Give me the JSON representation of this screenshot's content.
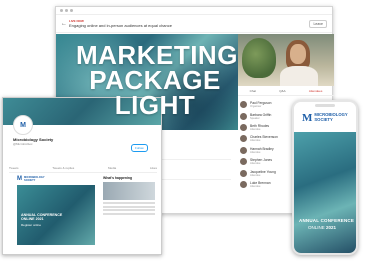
{
  "hero": {
    "title_line1": "MARKETING",
    "title_line2": "PACKAGE",
    "title_line3": "LIGHT"
  },
  "event_platform": {
    "session_tag": "LIVE NOW",
    "session_title": "Engaging online and in-person audiences at equal chance",
    "leave_label": "Leave",
    "tabs": [
      "Chat",
      "Q&A",
      "Attendees"
    ],
    "attendees": [
      {
        "name": "Paul Ferguson",
        "role": "Organiser"
      },
      {
        "name": "Barbara Griffin",
        "role": "Speaker"
      },
      {
        "name": "Beth Rhodes",
        "role": "Attendee"
      },
      {
        "name": "Charles Stevenson",
        "role": "Attendee"
      },
      {
        "name": "Hannah Bradley",
        "role": "Attendee"
      },
      {
        "name": "Stephen Jones",
        "role": "Attendee"
      },
      {
        "name": "Jacqueline Young",
        "role": "Attendee"
      },
      {
        "name": "Luke Brennan",
        "role": "Attendee"
      }
    ],
    "agenda_label": "SESSION INFO",
    "hosted_label": "Hosted",
    "speakers_label": "SPEAKERS",
    "hosts": [
      {
        "name": "Angel Hunter",
        "role": "Organiser"
      }
    ],
    "speakers": [
      {
        "name": "Steve Holloran",
        "role": "Speaker"
      }
    ]
  },
  "twitter": {
    "account_name": "Microbiology Society",
    "handle": "@MicrobioSoc",
    "tabs": [
      "Tweets",
      "Tweets & replies",
      "Media",
      "Likes"
    ],
    "follow_label": "Follow",
    "card_title_line1": "ANNUAL CONFERENCE",
    "card_title_line2": "ONLINE 2021",
    "card_sub": "Register online",
    "side_title": "What's happening",
    "logo_line1": "MICROBIOLOGY",
    "logo_line2": "SOCIETY"
  },
  "phone": {
    "logo_line1": "MICROBIOLOGY",
    "logo_line2": "SOCIETY",
    "conference": "ANNUAL CONFERENCE",
    "online": "ONLINE",
    "year": "2021"
  },
  "colors": {
    "brand_blue": "#1f5fa8",
    "teal": "#2a6d80",
    "accent_red": "#d0342c"
  }
}
